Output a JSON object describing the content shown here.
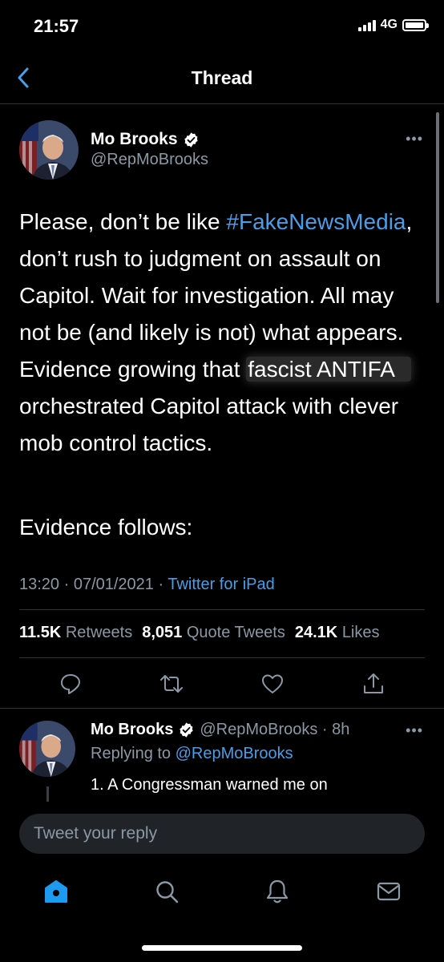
{
  "status_bar": {
    "time": "21:57",
    "network": "4G",
    "battery_level": 1.0
  },
  "nav": {
    "title": "Thread"
  },
  "tweet": {
    "author_name": "Mo Brooks",
    "author_handle": "@RepMoBrooks",
    "text_part1": "Please, don’t be like ",
    "hashtag": "#FakeNewsMedia",
    "text_part2": ", don’t rush to judgment on assault on Capitol. Wait for investigation. All may not be (and likely is not) what appears. Evidence growing that ",
    "highlighted": "fascist ANTIFA",
    "text_part3": " orchestrated Capitol attack with clever mob control tactics.",
    "text_part4": "Evidence follows:",
    "timestamp": "13:20 · 07/01/2021 · ",
    "source": "Twitter for iPad",
    "retweets_count": "11.5K",
    "retweets_label": "Retweets",
    "quotes_count": "8,051",
    "quotes_label": "Quote Tweets",
    "likes_count": "24.1K",
    "likes_label": "Likes"
  },
  "reply": {
    "author_name": "Mo Brooks",
    "author_handle": "@RepMoBrooks · 8h",
    "replying_prefix": "Replying to ",
    "replying_to": "@RepMoBrooks",
    "text": "1. A Congressman warned me on"
  },
  "compose": {
    "placeholder": "Tweet your reply"
  },
  "colors": {
    "accent": "#4a9ee8",
    "secondary": "#8b98a5",
    "divider": "#2f3336",
    "background": "#000000"
  },
  "icons": [
    "back-chevron-icon",
    "verified-icon",
    "more-icon",
    "reply-icon",
    "retweet-icon",
    "like-icon",
    "share-icon",
    "home-icon",
    "search-icon",
    "notifications-icon",
    "messages-icon"
  ]
}
